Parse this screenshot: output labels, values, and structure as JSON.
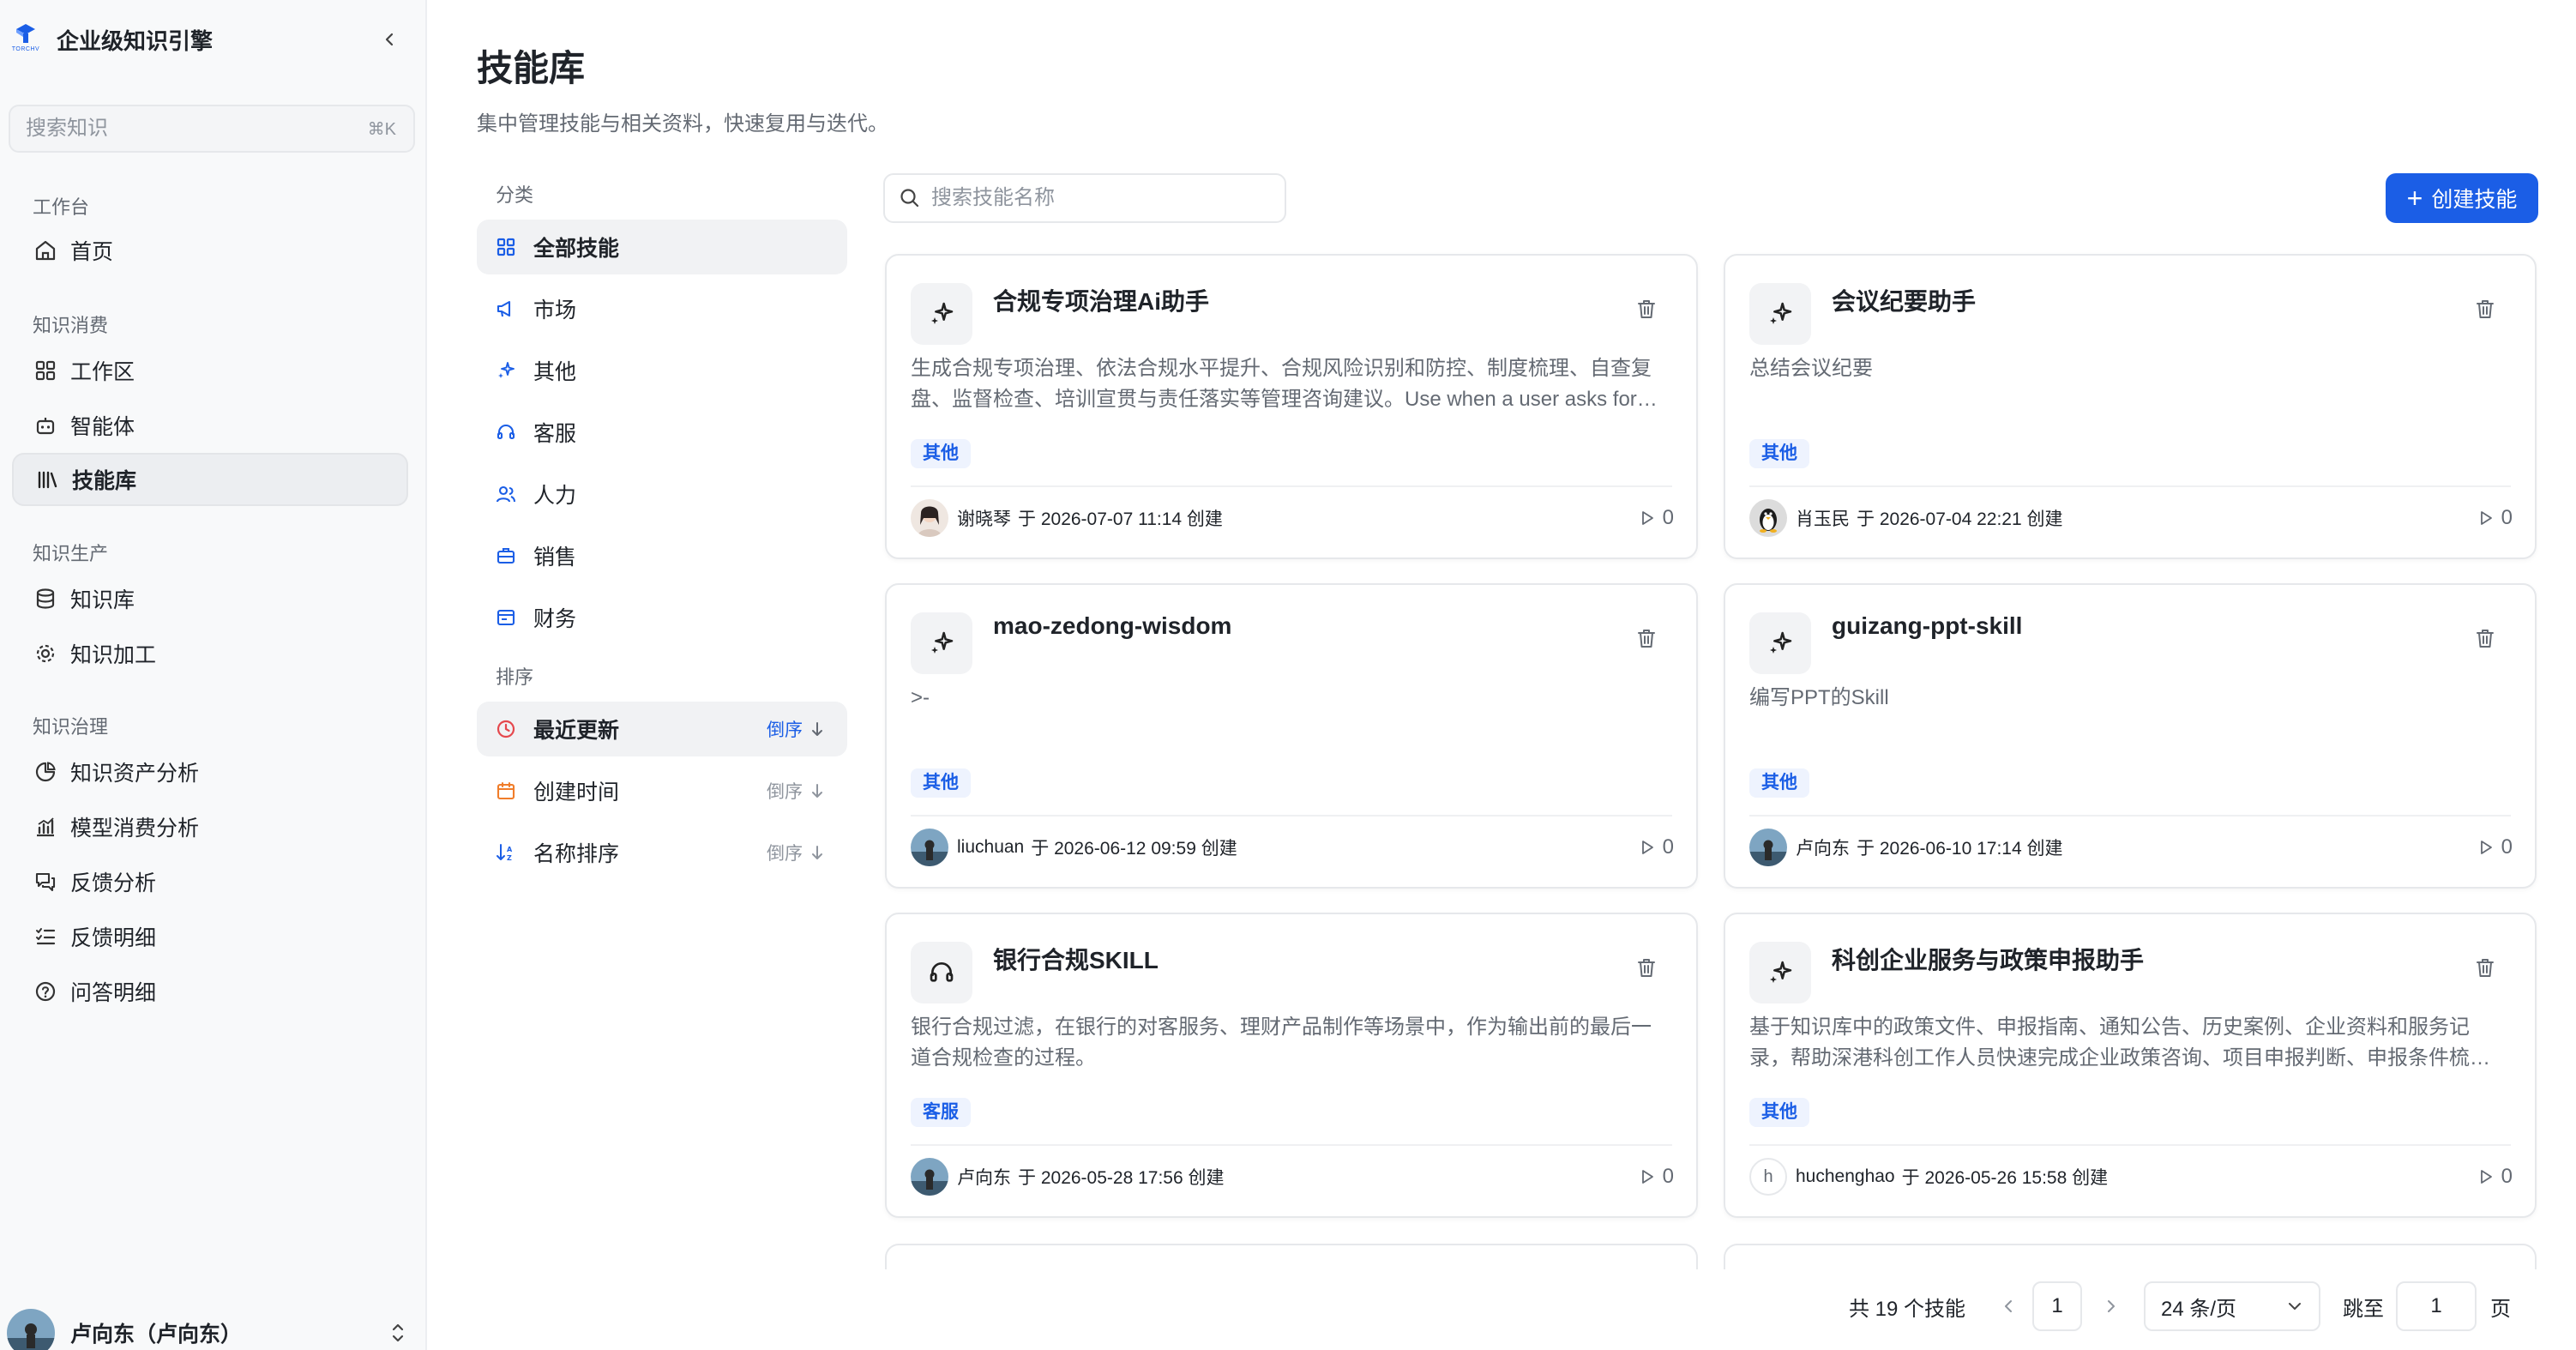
{
  "app": {
    "title": "企业级知识引擎",
    "logo_text": "TORCHV"
  },
  "sidebar": {
    "search": {
      "placeholder": "搜索知识",
      "shortcut": "⌘K"
    },
    "groups": [
      {
        "label": "工作台",
        "items": [
          {
            "label": "首页",
            "icon": "home-icon"
          }
        ]
      },
      {
        "label": "知识消费",
        "items": [
          {
            "label": "工作区",
            "icon": "grid-icon"
          },
          {
            "label": "智能体",
            "icon": "bot-icon"
          },
          {
            "label": "技能库",
            "icon": "library-icon",
            "active": true
          }
        ]
      },
      {
        "label": "知识生产",
        "items": [
          {
            "label": "知识库",
            "icon": "database-icon"
          },
          {
            "label": "知识加工",
            "icon": "gear-icon"
          }
        ]
      },
      {
        "label": "知识治理",
        "items": [
          {
            "label": "知识资产分析",
            "icon": "pie-chart-icon"
          },
          {
            "label": "模型消费分析",
            "icon": "bar-chart-icon"
          },
          {
            "label": "反馈分析",
            "icon": "chat-icon"
          },
          {
            "label": "反馈明细",
            "icon": "checklist-icon"
          },
          {
            "label": "问答明细",
            "icon": "help-circle-icon"
          }
        ]
      }
    ],
    "user": {
      "name": "卢向东（卢向东）"
    }
  },
  "main": {
    "title": "技能库",
    "description": "集中管理技能与相关资料，快速复用与迭代。",
    "category_label": "分类",
    "categories": [
      {
        "label": "全部技能",
        "icon": "grid-icon",
        "active": true
      },
      {
        "label": "市场",
        "icon": "megaphone-icon"
      },
      {
        "label": "其他",
        "icon": "sparkle-icon"
      },
      {
        "label": "客服",
        "icon": "headset-icon"
      },
      {
        "label": "人力",
        "icon": "users-icon"
      },
      {
        "label": "销售",
        "icon": "briefcase-icon"
      },
      {
        "label": "财务",
        "icon": "wallet-icon"
      }
    ],
    "sort_label": "排序",
    "sorts": [
      {
        "label": "最近更新",
        "order": "倒序",
        "icon": "clock-icon",
        "active": true
      },
      {
        "label": "创建时间",
        "order": "倒序",
        "icon": "calendar-icon"
      },
      {
        "label": "名称排序",
        "order": "倒序",
        "icon": "sort-alpha-icon"
      }
    ],
    "search_placeholder": "搜索技能名称",
    "create_button": "创建技能",
    "skills": [
      {
        "title": "合规专项治理Ai助手",
        "icon": "sparkle-icon",
        "desc": "生成合规专项治理、依法合规水平提升、合规风险识别和防控、制度梳理、自查复盘、监督检查、培训宣贯与责任落实等管理咨询建议。Use when a user asks for help with compliance governance.",
        "tag": "其他",
        "author": "谢晓琴",
        "meta": "于 2026-07-07 11:14 创建",
        "runs": "0",
        "avatar": "portrait"
      },
      {
        "title": "会议纪要助手",
        "icon": "sparkle-icon",
        "desc": "总结会议纪要",
        "tag": "其他",
        "author": "肖玉民",
        "meta": "于 2026-07-04 22:21 创建",
        "runs": "0",
        "avatar": "penguin"
      },
      {
        "title": "mao-zedong-wisdom",
        "icon": "sparkle-icon",
        "desc": ">-",
        "tag": "其他",
        "author": "liuchuan",
        "meta": "于 2026-06-12 09:59 创建",
        "runs": "0",
        "avatar": "photo"
      },
      {
        "title": "guizang-ppt-skill",
        "icon": "sparkle-icon",
        "desc": "编写PPT的Skill",
        "tag": "其他",
        "author": "卢向东",
        "meta": "于 2026-06-10 17:14 创建",
        "runs": "0",
        "avatar": "photo"
      },
      {
        "title": "银行合规SKILL",
        "icon": "headset-icon",
        "desc": "银行合规过滤，在银行的对客服务、理财产品制作等场景中，作为输出前的最后一道合规检查的过程。",
        "tag": "客服",
        "author": "卢向东",
        "meta": "于 2026-05-28 17:56 创建",
        "runs": "0",
        "avatar": "photo"
      },
      {
        "title": "科创企业服务与政策申报助手",
        "icon": "sparkle-icon",
        "desc": "基于知识库中的政策文件、申报指南、通知公告、历史案例、企业资料和服务记录，帮助深港科创工作人员快速完成企业政策咨询、项目申报判断、申报条件梳理等工作。",
        "tag": "其他",
        "author": "huchenghao",
        "meta": "于 2026-05-26 15:58 创建",
        "runs": "0",
        "avatar": "letter",
        "avatar_letter": "h"
      }
    ],
    "pagination": {
      "total_text": "共 19 个技能",
      "current_page": "1",
      "page_size": "24 条/页",
      "jump_label": "跳至",
      "jump_value": "1",
      "page_unit": "页"
    }
  },
  "colors": {
    "accent": "#1b5ee6",
    "tag_bg": "#eef3fe",
    "sort_active": "#e5484d",
    "sort_orange": "#f07d2a"
  }
}
